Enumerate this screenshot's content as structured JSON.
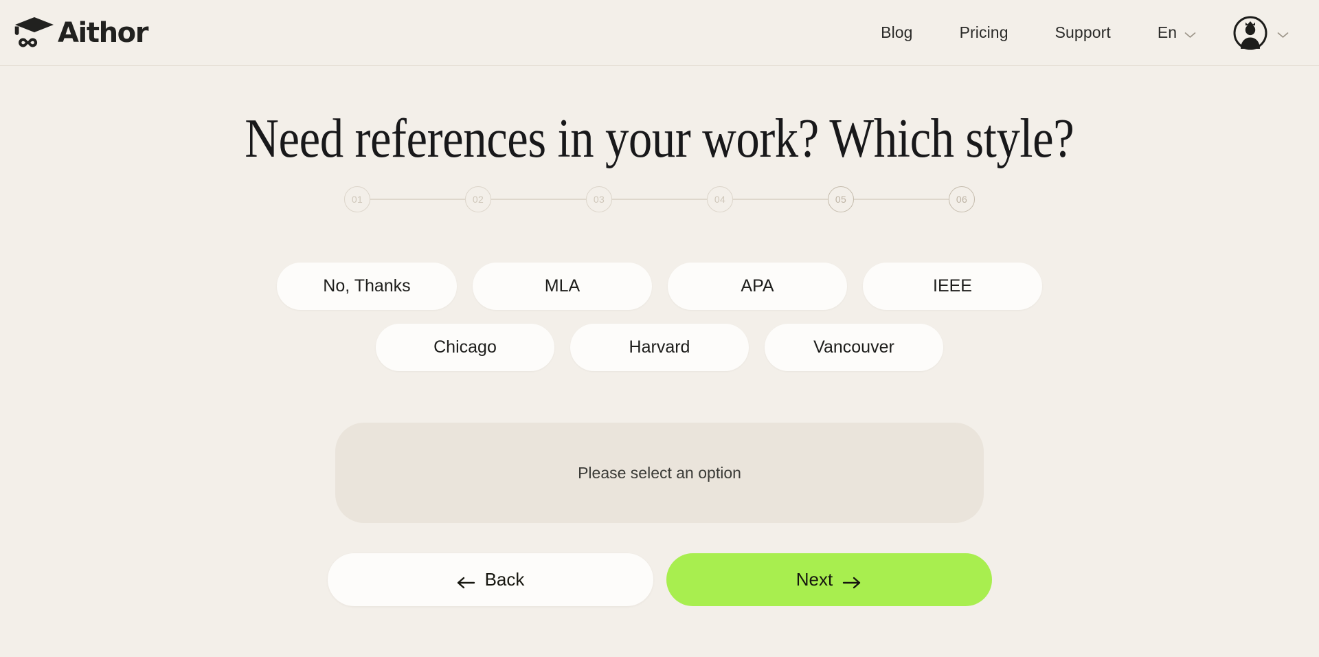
{
  "brand": {
    "name": "Aithor",
    "logo_icon": "graduation-cap-infinity-icon"
  },
  "header": {
    "nav": [
      {
        "label": "Blog",
        "name": "blog"
      },
      {
        "label": "Pricing",
        "name": "pricing"
      },
      {
        "label": "Support",
        "name": "support"
      }
    ],
    "language": {
      "label": "En",
      "chevron_icon": "chevron-down-icon"
    },
    "account": {
      "avatar_icon": "user-crown-avatar-icon",
      "chevron_icon": "chevron-down-icon"
    }
  },
  "main": {
    "title": "Need references in your work? Which style?",
    "stepper": {
      "steps": [
        {
          "label": "01",
          "active": false
        },
        {
          "label": "02",
          "active": false
        },
        {
          "label": "03",
          "active": false
        },
        {
          "label": "04",
          "active": false
        },
        {
          "label": "05",
          "active": true
        },
        {
          "label": "06",
          "active": true
        }
      ]
    },
    "options": {
      "row1": [
        {
          "label": "No, Thanks",
          "name": "no-thanks"
        },
        {
          "label": "MLA",
          "name": "mla"
        },
        {
          "label": "APA",
          "name": "apa"
        },
        {
          "label": "IEEE",
          "name": "ieee"
        }
      ],
      "row2": [
        {
          "label": "Chicago",
          "name": "chicago"
        },
        {
          "label": "Harvard",
          "name": "harvard"
        },
        {
          "label": "Vancouver",
          "name": "vancouver"
        }
      ]
    },
    "notice": "Please select an option",
    "actions": {
      "back": {
        "label": "Back",
        "icon": "arrow-left-icon"
      },
      "next": {
        "label": "Next",
        "icon": "arrow-right-icon"
      }
    }
  },
  "colors": {
    "background": "#F3EFE9",
    "surface": "#FDFCFA",
    "notice_bg": "#EAE4DB",
    "accent_green": "#A8EE4F",
    "text": "#1D1D1B",
    "step_inactive": "#DCD5CA",
    "step_active": "#C4BBAC"
  }
}
